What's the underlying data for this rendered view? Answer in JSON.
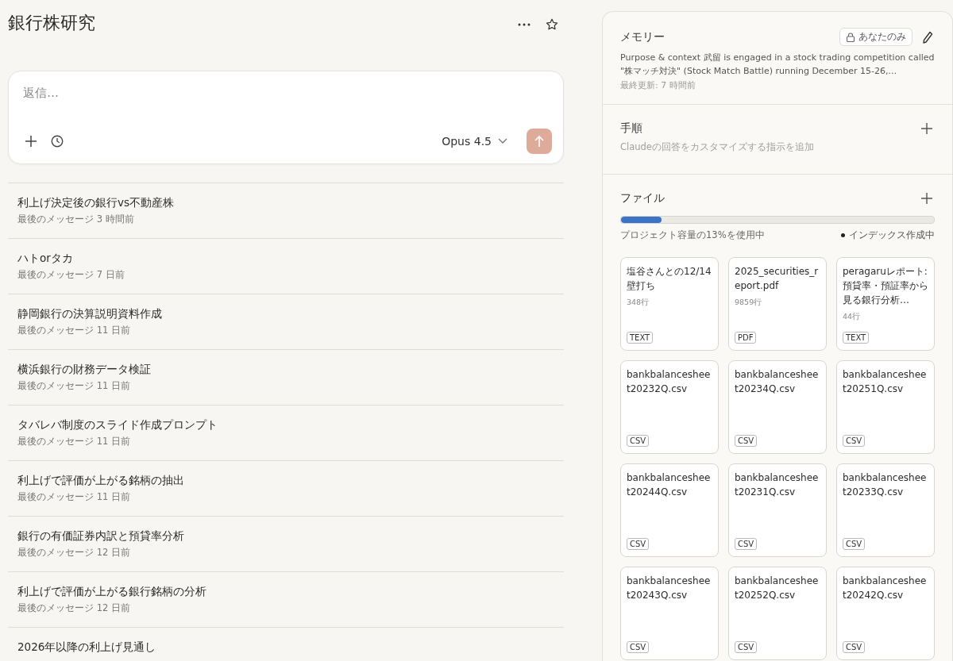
{
  "project": {
    "title": "銀行株研究"
  },
  "composer": {
    "placeholder": "返信…",
    "model": "Opus 4.5"
  },
  "conversations": [
    {
      "title": "利上げ決定後の銀行vs不動産株",
      "meta": "最後のメッセージ 3 時間前"
    },
    {
      "title": "ハトorタカ",
      "meta": "最後のメッセージ 7 日前"
    },
    {
      "title": "静岡銀行の決算説明資料作成",
      "meta": "最後のメッセージ 11 日前"
    },
    {
      "title": "横浜銀行の財務データ検証",
      "meta": "最後のメッセージ 11 日前"
    },
    {
      "title": "タバレバ制度のスライド作成プロンプト",
      "meta": "最後のメッセージ 11 日前"
    },
    {
      "title": "利上げで評価が上がる銘柄の抽出",
      "meta": "最後のメッセージ 11 日前"
    },
    {
      "title": "銀行の有価証券内訳と預貸率分析",
      "meta": "最後のメッセージ 12 日前"
    },
    {
      "title": "利上げで評価が上がる銀行銘柄の分析",
      "meta": "最後のメッセージ 12 日前"
    },
    {
      "title": "2026年以降の利上げ見通し"
    }
  ],
  "memory": {
    "title": "メモリー",
    "visibility": "あなたのみ",
    "text": "Purpose & context 武留 is engaged in a stock trading competition called \"株マッチ対決\" (Stock Match Battle) running December 15-26,…",
    "updated": "最終更新: 7 時間前"
  },
  "instructions": {
    "title": "手順",
    "hint": "Claudeの回答をカスタマイズする指示を追加"
  },
  "files": {
    "title": "ファイル",
    "level": 0.13,
    "usage": "プロジェクト容量の13%を使用中",
    "index_status": "インデックス作成中",
    "items": [
      {
        "name": "塩谷さんとの12/14壁打ち",
        "lines": "348行",
        "type": "TEXT"
      },
      {
        "name": "2025_securities_report.pdf",
        "lines": "9859行",
        "type": "PDF"
      },
      {
        "name": "peragaruレポート: 預貸率・預証率から見る銀行分析…",
        "lines": "44行",
        "type": "TEXT"
      },
      {
        "name": "bankbalancesheet20232Q.csv",
        "type": "CSV"
      },
      {
        "name": "bankbalancesheet20234Q.csv",
        "type": "CSV"
      },
      {
        "name": "bankbalancesheet20251Q.csv",
        "type": "CSV"
      },
      {
        "name": "bankbalancesheet20244Q.csv",
        "type": "CSV"
      },
      {
        "name": "bankbalancesheet20231Q.csv",
        "type": "CSV"
      },
      {
        "name": "bankbalancesheet20233Q.csv",
        "type": "CSV"
      },
      {
        "name": "bankbalancesheet20243Q.csv",
        "type": "CSV"
      },
      {
        "name": "bankbalancesheet20252Q.csv",
        "type": "CSV"
      },
      {
        "name": "bankbalancesheet20242Q.csv",
        "type": "CSV"
      }
    ]
  }
}
